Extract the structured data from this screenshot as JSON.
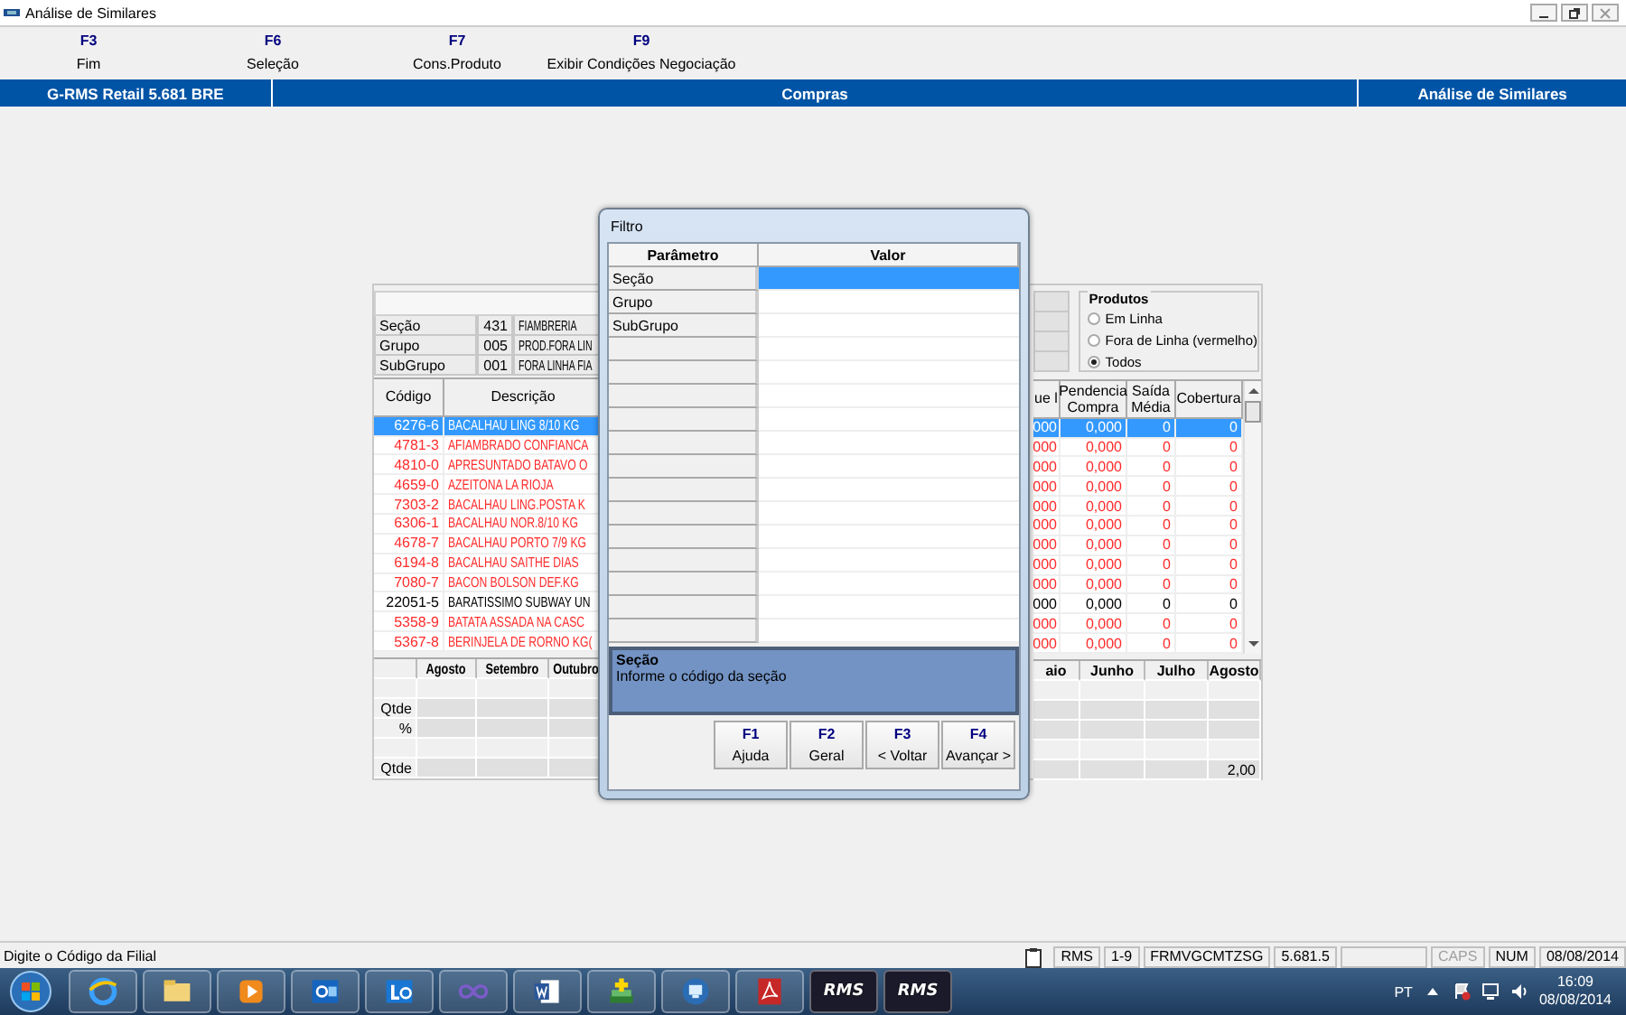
{
  "window": {
    "title": "Análise de Similares"
  },
  "function_keys": [
    {
      "key": "F3",
      "label": "Fim"
    },
    {
      "key": "F6",
      "label": "Seleção"
    },
    {
      "key": "F7",
      "label": "Cons.Produto"
    },
    {
      "key": "F9",
      "label": "Exibir Condições Negociação"
    }
  ],
  "header_bar": {
    "version": "G-RMS Retail 5.681 BRE",
    "module": "Compras",
    "screen": "Análise de Similares"
  },
  "filters": [
    {
      "label": "Seção",
      "code": "431",
      "name": "FIAMBRERIA"
    },
    {
      "label": "Grupo",
      "code": "005",
      "name": "PROD.FORA LIN"
    },
    {
      "label": "SubGrupo",
      "code": "001",
      "name": "FORA LINHA FIA"
    }
  ],
  "produtos": {
    "title": "Produtos",
    "options": [
      {
        "label": "Em Linha",
        "selected": false
      },
      {
        "label": "Fora de Linha (vermelho)",
        "selected": false
      },
      {
        "label": "Todos",
        "selected": true
      }
    ]
  },
  "grid": {
    "columns": [
      "Código",
      "Descrição",
      "ue l",
      "Pendencia Compra",
      "Saída Média",
      "Cobertura"
    ],
    "rows": [
      {
        "cells": [
          "6276-6",
          "BACALHAU LING 8/10 KG",
          "000",
          "0,000",
          "0",
          "0"
        ],
        "selected": true,
        "discontinued": false
      },
      {
        "cells": [
          "4781-3",
          "AFIAMBRADO CONFIANCA",
          "000",
          "0,000",
          "0",
          "0"
        ],
        "selected": false,
        "discontinued": true
      },
      {
        "cells": [
          "4810-0",
          "APRESUNTADO BATAVO O",
          "000",
          "0,000",
          "0",
          "0"
        ],
        "selected": false,
        "discontinued": true
      },
      {
        "cells": [
          "4659-0",
          "AZEITONA LA RIOJA",
          "000",
          "0,000",
          "0",
          "0"
        ],
        "selected": false,
        "discontinued": true
      },
      {
        "cells": [
          "7303-2",
          "BACALHAU LING.POSTA K",
          "000",
          "0,000",
          "0",
          "0"
        ],
        "selected": false,
        "discontinued": true
      },
      {
        "cells": [
          "6306-1",
          "BACALHAU NOR.8/10 KG",
          "000",
          "0,000",
          "0",
          "0"
        ],
        "selected": false,
        "discontinued": true
      },
      {
        "cells": [
          "4678-7",
          "BACALHAU PORTO 7/9 KG",
          "000",
          "0,000",
          "0",
          "0"
        ],
        "selected": false,
        "discontinued": true
      },
      {
        "cells": [
          "6194-8",
          "BACALHAU SAITHE DIAS",
          "000",
          "0,000",
          "0",
          "0"
        ],
        "selected": false,
        "discontinued": true
      },
      {
        "cells": [
          "7080-7",
          "BACON BOLSON DEF.KG",
          "000",
          "0,000",
          "0",
          "0"
        ],
        "selected": false,
        "discontinued": true
      },
      {
        "cells": [
          "22051-5",
          "BARATISSIMO SUBWAY UN",
          "000",
          "0,000",
          "0",
          "0"
        ],
        "selected": false,
        "discontinued": false
      },
      {
        "cells": [
          "5358-9",
          "BATATA ASSADA NA CASC",
          "000",
          "0,000",
          "0",
          "0"
        ],
        "selected": false,
        "discontinued": true
      },
      {
        "cells": [
          "5367-8",
          "BERINJELA DE RORNO KG(",
          "000",
          "0,000",
          "0",
          "0"
        ],
        "selected": false,
        "discontinued": true
      }
    ]
  },
  "monthly_grid": {
    "columns": [
      "Agosto",
      "Setembro",
      "Outubro",
      "aio",
      "Junho",
      "Julho",
      "Agosto"
    ],
    "rows": [
      {
        "kind": "spacer"
      },
      {
        "kind": "data",
        "label": "Qtde"
      },
      {
        "kind": "data",
        "label": "%"
      },
      {
        "kind": "spacer"
      },
      {
        "kind": "data",
        "label": "Qtde",
        "total": "2,00"
      }
    ]
  },
  "dialog": {
    "title": "Filtro",
    "columns": [
      "Parâmetro",
      "Valor"
    ],
    "rows": [
      {
        "parameter": "Seção",
        "selected": true
      },
      {
        "parameter": "Grupo",
        "selected": false
      },
      {
        "parameter": "SubGrupo",
        "selected": false
      }
    ],
    "help": {
      "title": "Seção",
      "text": "Informe o código da seção"
    },
    "buttons": [
      {
        "key": "F1",
        "label": "Ajuda"
      },
      {
        "key": "F2",
        "label": "Geral"
      },
      {
        "key": "F3",
        "label": "< Voltar"
      },
      {
        "key": "F4",
        "label": "Avançar >"
      }
    ]
  },
  "status_bar": {
    "message": "Digite o Código da Filial",
    "panels": [
      {
        "kind": "icon"
      },
      {
        "kind": "text",
        "text": "RMS",
        "disabled": false
      },
      {
        "kind": "text",
        "text": "1-9",
        "disabled": false
      },
      {
        "kind": "text",
        "text": "FRMVGCMTZSG",
        "disabled": false
      },
      {
        "kind": "text",
        "text": "5.681.5",
        "disabled": false
      },
      {
        "kind": "blank"
      },
      {
        "kind": "text",
        "text": "CAPS",
        "disabled": true
      },
      {
        "kind": "text",
        "text": "NUM",
        "disabled": false
      },
      {
        "kind": "text",
        "text": "08/08/2014",
        "disabled": false
      }
    ]
  },
  "taskbar": {
    "apps": [
      {
        "kind": "ie"
      },
      {
        "kind": "folder"
      },
      {
        "kind": "media"
      },
      {
        "kind": "outlook"
      },
      {
        "kind": "lync"
      },
      {
        "kind": "loop"
      },
      {
        "kind": "word"
      },
      {
        "kind": "stack"
      },
      {
        "kind": "remote"
      },
      {
        "kind": "pdf"
      },
      {
        "kind": "rms",
        "text": "RMS"
      },
      {
        "kind": "rms",
        "text": "RMS"
      }
    ],
    "language": "PT",
    "time": "16:09",
    "date": "08/08/2014"
  }
}
